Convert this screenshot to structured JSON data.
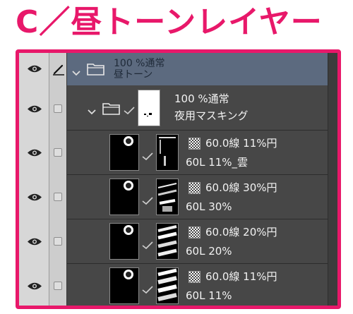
{
  "title": "C／昼トーンレイヤー",
  "colors": {
    "accent": "#e8186a",
    "selected_row": "#5c6a7f",
    "panel": "#474747"
  },
  "layers": [
    {
      "opacity_mode": "100 %通常",
      "name": "昼トーン",
      "type": "folder",
      "selected": true
    },
    {
      "opacity_mode": "100 %通常",
      "name": "夜用マスキング",
      "type": "folder",
      "selected": false
    },
    {
      "opacity_mode": "60.0線 11%円",
      "name": "60L 11%_雲",
      "type": "tone",
      "selected": false
    },
    {
      "opacity_mode": "60.0線 30%円",
      "name": "60L 30%",
      "type": "tone",
      "selected": false
    },
    {
      "opacity_mode": "60.0線 20%円",
      "name": "60L 20%",
      "type": "tone",
      "selected": false
    },
    {
      "opacity_mode": "60.0線 11%円",
      "name": "60L 11%",
      "type": "tone",
      "selected": false
    }
  ],
  "icons": {
    "visibility": "eye-icon",
    "edit": "pen-icon",
    "lock": "checkbox-icon",
    "expand": "chevron-down-icon",
    "folder": "folder-icon",
    "mask_link": "check-icon",
    "tone_type": "tone-pattern-icon",
    "tone_badge": "tone-badge-icon"
  }
}
